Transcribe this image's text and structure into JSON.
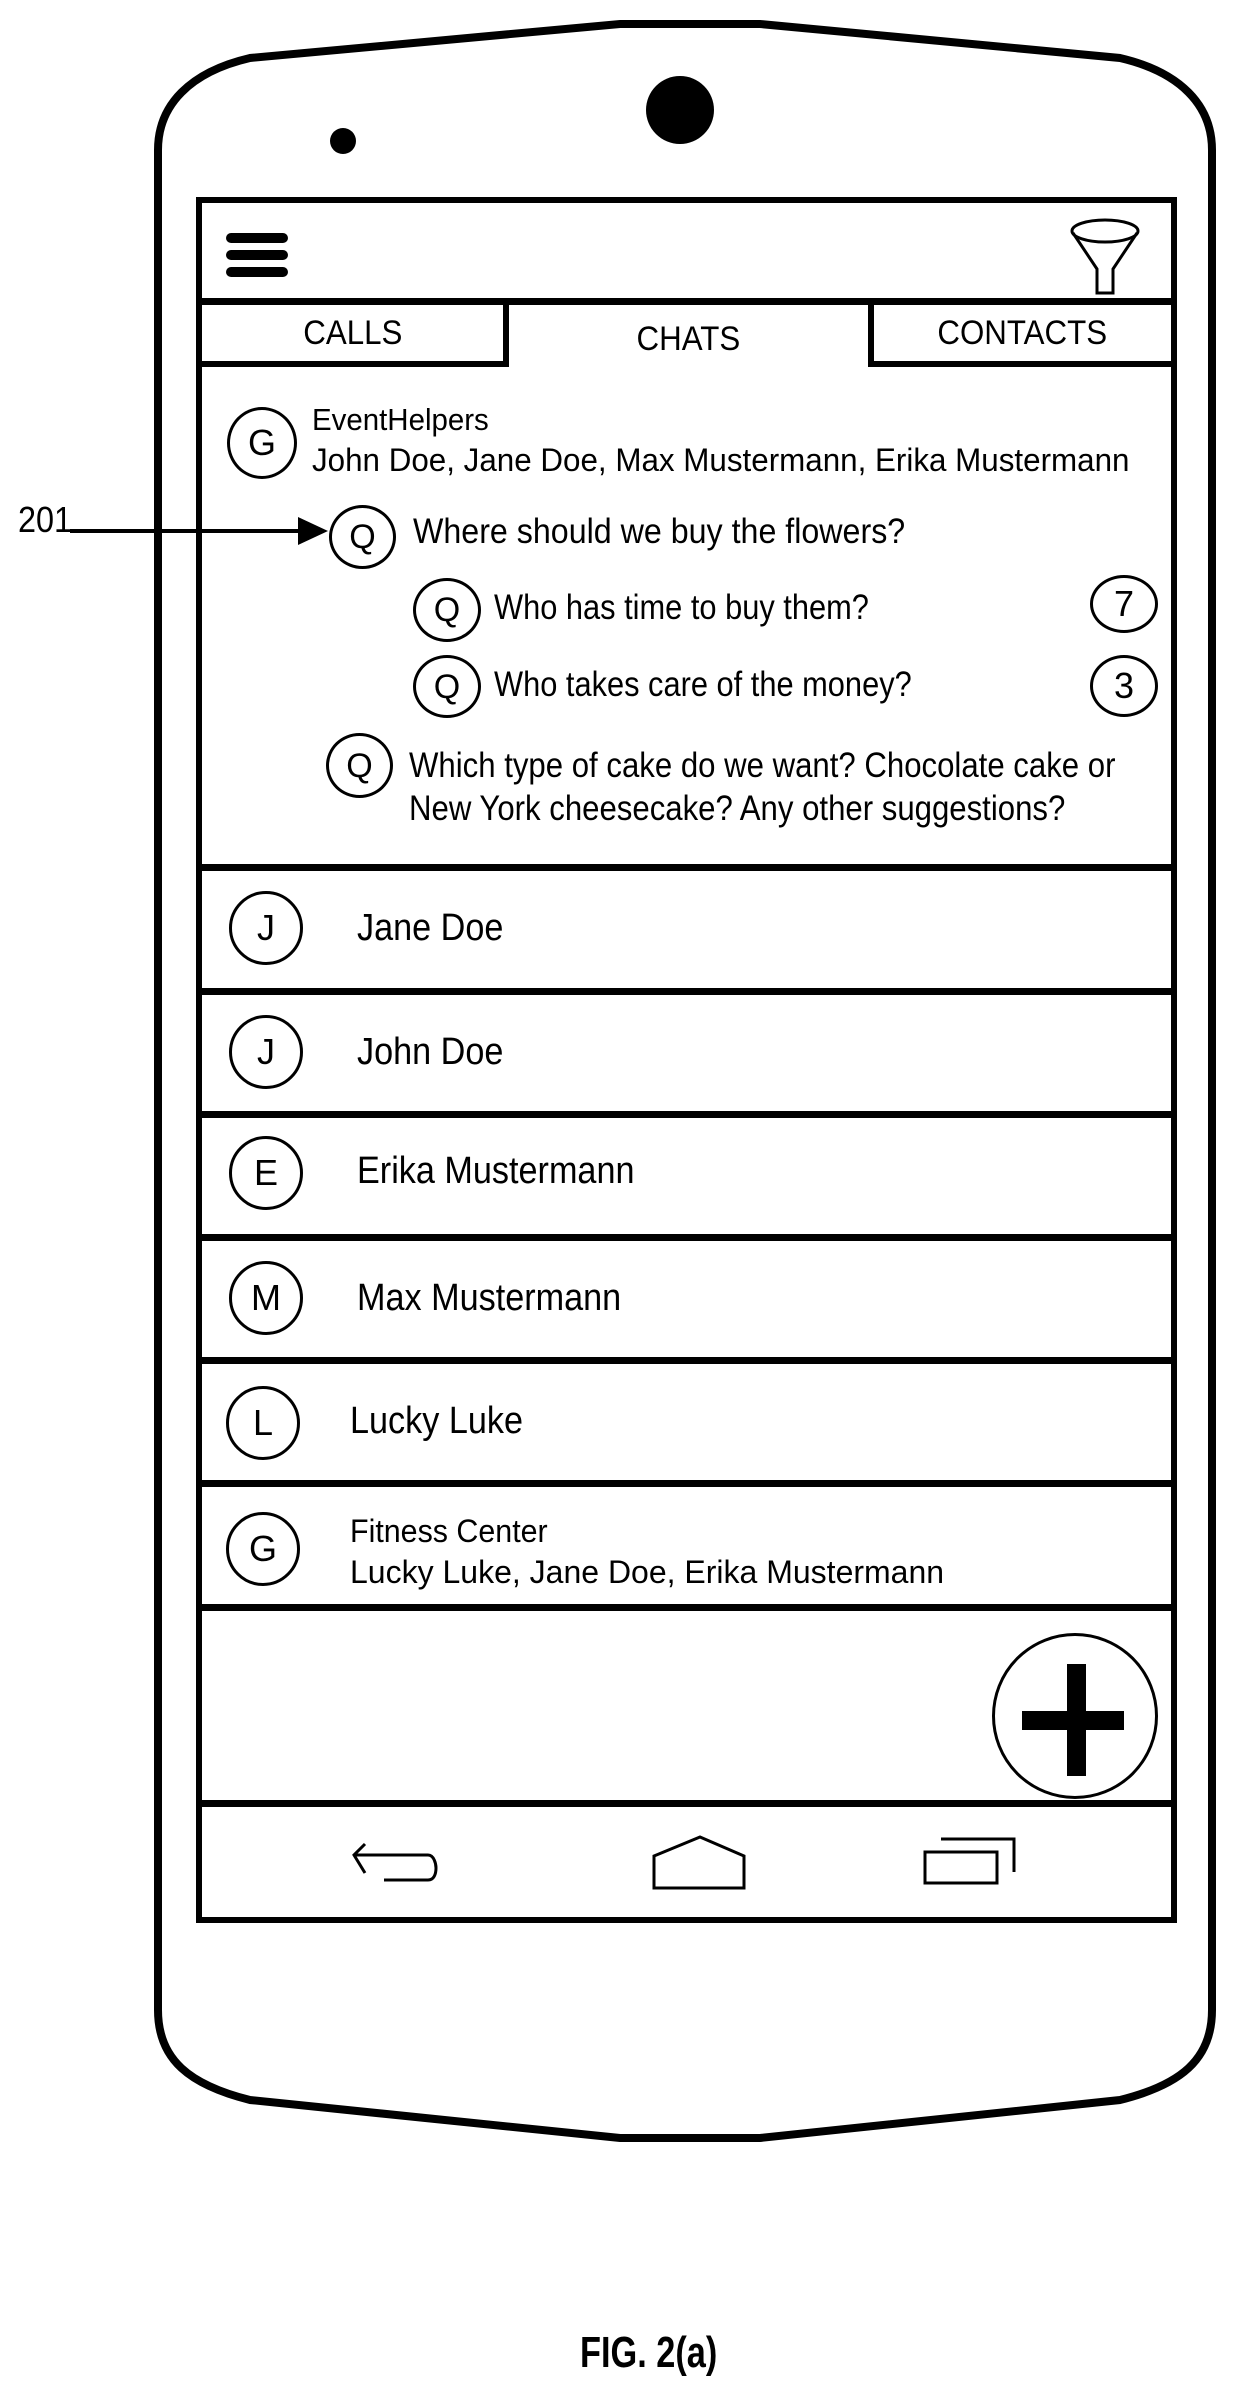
{
  "header": {
    "menu_icon": "hamburger-menu-icon",
    "filter_icon": "funnel-filter-icon"
  },
  "tabs": [
    {
      "label": "CALLS",
      "active": false
    },
    {
      "label": "CHATS",
      "active": true
    },
    {
      "label": "CONTACTS",
      "active": false
    }
  ],
  "group_chat": {
    "avatar_letter": "G",
    "name": "EventHelpers",
    "members": "John Doe, Jane Doe, Max Mustermann, Erika Mustermann",
    "questions": [
      {
        "icon_letter": "Q",
        "text": "Where should we buy the flowers?",
        "badge": null,
        "sub_questions": [
          {
            "icon_letter": "Q",
            "text": "Who has time to buy them?",
            "badge": "7"
          },
          {
            "icon_letter": "Q",
            "text": "Who takes care of the money?",
            "badge": "3"
          }
        ]
      },
      {
        "icon_letter": "Q",
        "text_line1": "Which type of cake do we want? Chocolate cake or",
        "text_line2": "New York cheesecake? Any other suggestions?",
        "badge": null
      }
    ]
  },
  "chats": [
    {
      "avatar_letter": "J",
      "name": "Jane Doe"
    },
    {
      "avatar_letter": "J",
      "name": "John Doe"
    },
    {
      "avatar_letter": "E",
      "name": "Erika Mustermann"
    },
    {
      "avatar_letter": "M",
      "name": "Max Mustermann"
    },
    {
      "avatar_letter": "L",
      "name": "Lucky Luke"
    },
    {
      "avatar_letter": "G",
      "name": "Fitness Center",
      "members": "Lucky Luke, Jane Doe, Erika Mustermann"
    }
  ],
  "fab": {
    "icon": "plus-icon"
  },
  "navbar": {
    "back_icon": "back-arrow-icon",
    "home_icon": "home-icon",
    "recents_icon": "recent-apps-icon"
  },
  "annotation": {
    "reference_numeral": "201"
  },
  "figure_caption": "FIG. 2(a)"
}
